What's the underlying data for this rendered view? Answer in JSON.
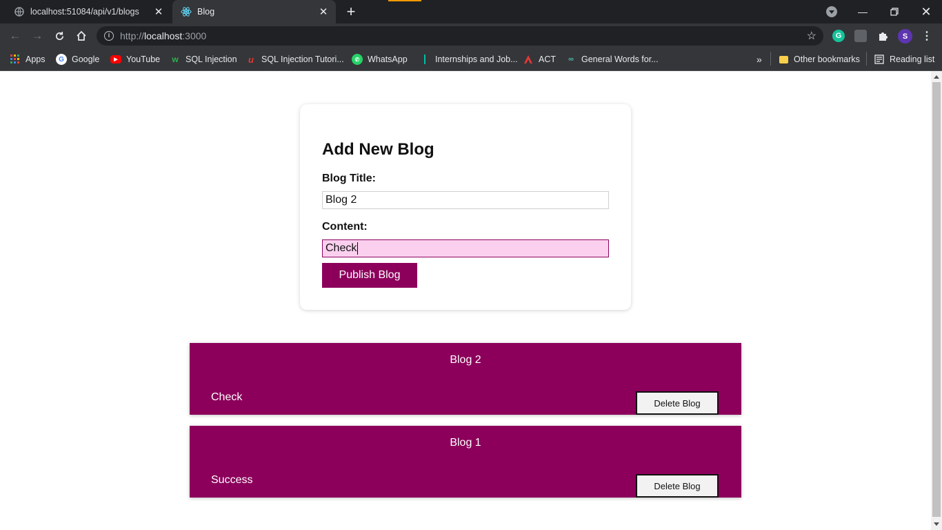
{
  "browser": {
    "tabs": [
      {
        "title": "localhost:51084/api/v1/blogs",
        "active": false
      },
      {
        "title": "Blog",
        "active": true
      }
    ],
    "address": {
      "scheme": "http://",
      "host": "localhost",
      "port": ":3000"
    },
    "profile_initial": "S",
    "grammarly_initial": "G",
    "bookmarks": [
      {
        "label": "Apps",
        "icon": "apps-grid-icon"
      },
      {
        "label": "Google",
        "icon": "google-icon"
      },
      {
        "label": "YouTube",
        "icon": "youtube-icon"
      },
      {
        "label": "SQL Injection",
        "icon": "w-logo-icon"
      },
      {
        "label": "SQL Injection Tutori...",
        "icon": "u-logo-icon"
      },
      {
        "label": "WhatsApp",
        "icon": "whatsapp-icon"
      },
      {
        "label": "Internships and Job...",
        "icon": "bar-icon"
      },
      {
        "label": "ACT",
        "icon": "act-icon"
      },
      {
        "label": "General Words for...",
        "icon": "link-icon"
      }
    ],
    "overflow_label": "»",
    "other_bookmarks": "Other bookmarks",
    "reading_list": "Reading list"
  },
  "form": {
    "heading": "Add New Blog",
    "title_label": "Blog Title:",
    "title_value": "Blog 2",
    "content_label": "Content:",
    "content_value": "Check",
    "publish_label": "Publish Blog"
  },
  "blogs": [
    {
      "title": "Blog 2",
      "content": "Check",
      "delete_label": "Delete Blog"
    },
    {
      "title": "Blog 1",
      "content": "Success",
      "delete_label": "Delete Blog"
    }
  ],
  "colors": {
    "accent": "#8c005b",
    "focused_input": "#fbd0ee"
  }
}
